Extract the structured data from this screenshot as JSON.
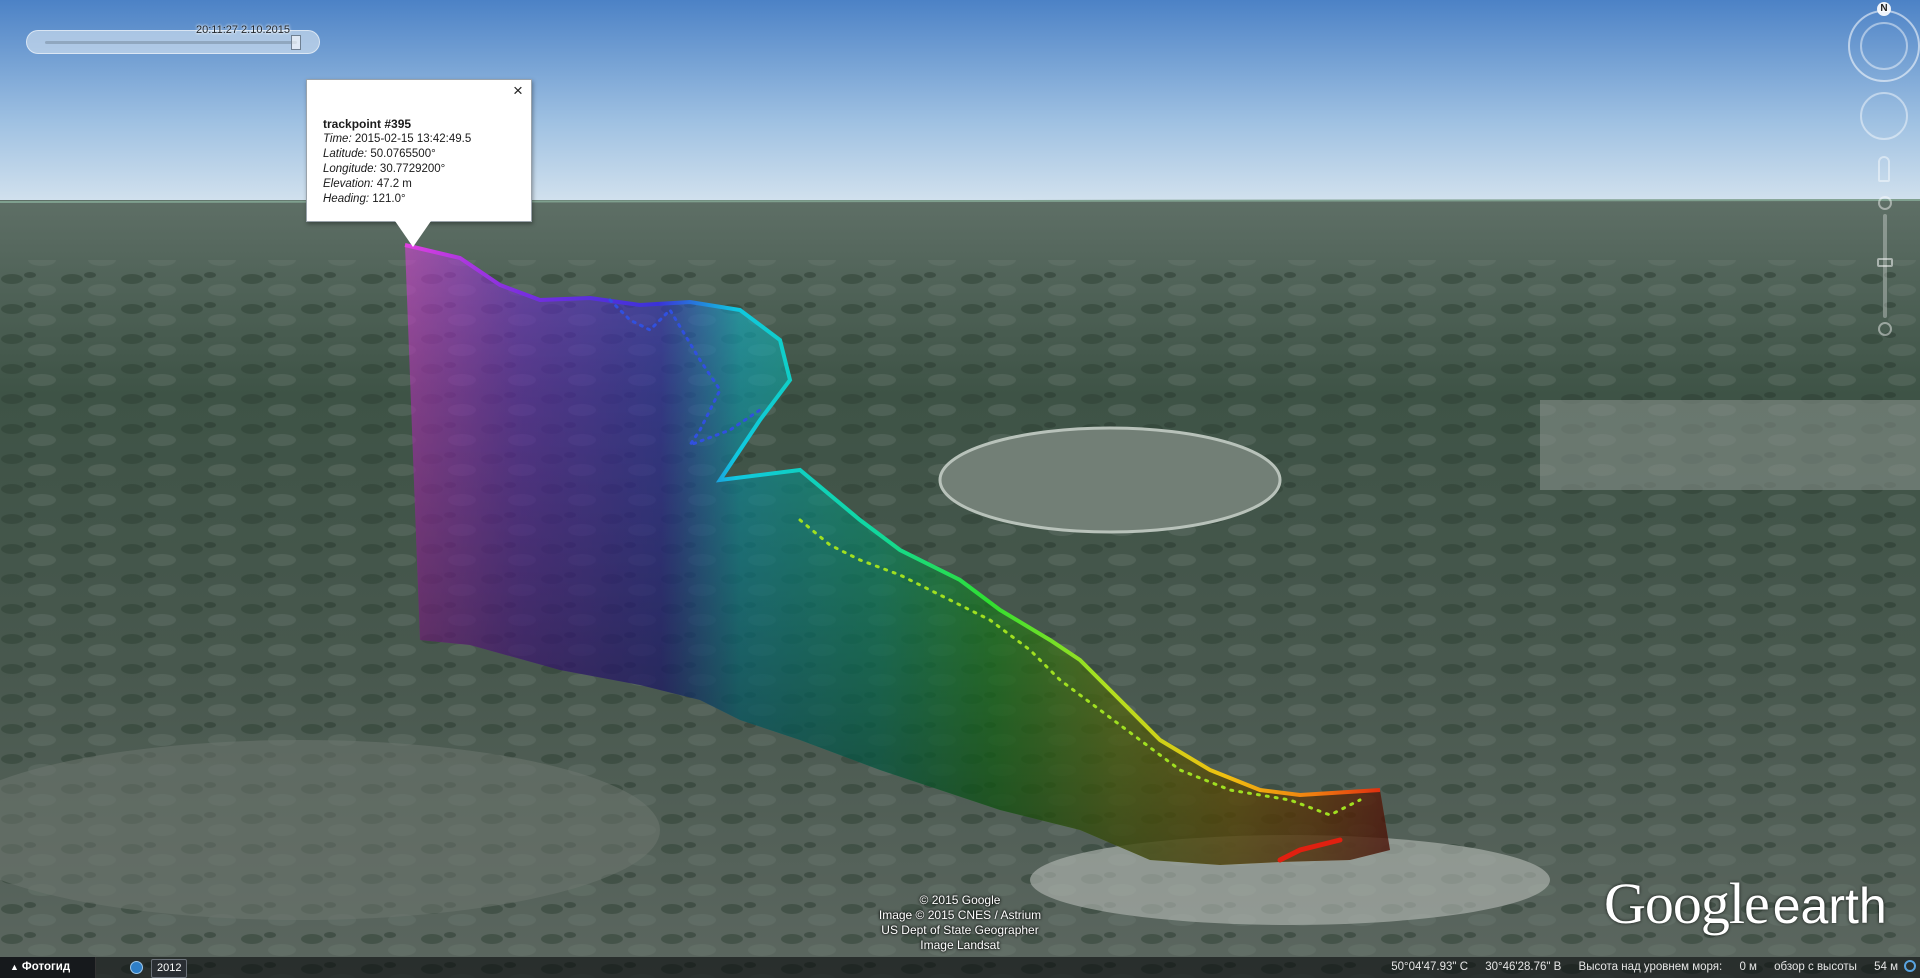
{
  "window": {
    "app": "Google Earth"
  },
  "time_slider": {
    "label": "20:11:27 2.10.2015"
  },
  "balloon": {
    "title": "trackpoint #395",
    "close_symbol": "×",
    "rows": [
      {
        "key": "Time:",
        "value": "2015-02-15 13:42:49.5"
      },
      {
        "key": "Latitude:",
        "value": "50.0765500°"
      },
      {
        "key": "Longitude:",
        "value": "30.7729200°"
      },
      {
        "key": "Elevation:",
        "value": "47.2 m"
      },
      {
        "key": "Heading:",
        "value": "121.0°"
      }
    ]
  },
  "navigation": {
    "north_label": "N"
  },
  "attribution": {
    "lines": [
      "© 2015 Google",
      "Image © 2015 CNES / Astrium",
      "US Dept of State Geographer",
      "Image Landsat"
    ]
  },
  "logo": {
    "google": "Google",
    "earth": "earth"
  },
  "status_bar": {
    "tour_label": "Фотогид",
    "history_year": "2012",
    "latitude": "50°04'47.93\" С",
    "longitude": "30°46'28.76\" В",
    "elevation_label": "Высота над уровнем моря:",
    "elevation_value": "0 м",
    "eye_alt_label": "обзор с высоты",
    "eye_alt_value": "54 м"
  },
  "colors": {
    "sky_top": "#4c82c6",
    "sky_horizon": "#cfe0ee",
    "track_start": "#e040e0",
    "track_end": "#e03010",
    "status_bar_bg": "#0a0c0e"
  },
  "icons": {
    "close": "close-icon",
    "compass": "compass-icon",
    "look": "look-joystick-icon",
    "street_view": "pegman-icon",
    "history": "historical-imagery-icon"
  }
}
